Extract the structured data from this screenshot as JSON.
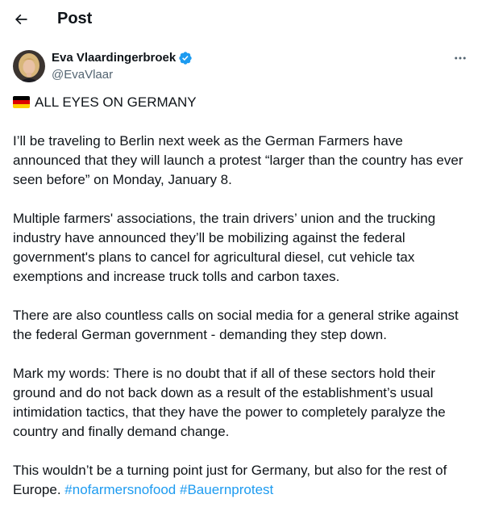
{
  "header": {
    "back_icon": "arrow-left-icon",
    "title": "Post"
  },
  "author": {
    "display_name": "Eva Vlaardingerbroek",
    "handle": "@EvaVlaar",
    "verified": true,
    "verified_color": "#1d9bf0",
    "more_icon": "more-horizontal-icon"
  },
  "post": {
    "flag_icon": "germany-flag-icon",
    "headline": "ALL EYES ON GERMANY",
    "paragraphs": [
      "I’ll be traveling to Berlin next week as the German Farmers have announced that they will launch a protest “larger than the country has ever seen before” on Monday, January 8.",
      "Multiple farmers' associations, the train drivers’ union and the trucking industry have announced they’ll be mobilizing against the federal government's plans to cancel for agricultural diesel, cut vehicle tax exemptions and increase truck tolls and carbon taxes.",
      "There are also countless calls on social media for a general strike against the federal German government - demanding they step down.",
      "Mark my words: There is no doubt that if all of these sectors hold their ground and do not back down as a result of the establishment’s usual intimidation tactics, that they have the power to completely paralyze the country and finally demand change.",
      "This wouldn’t be a turning point just for Germany, but also for the rest of Europe."
    ],
    "hashtags": [
      "#nofarmersnofood",
      "#Bauernprotest"
    ],
    "link_color": "#1d9bf0"
  }
}
